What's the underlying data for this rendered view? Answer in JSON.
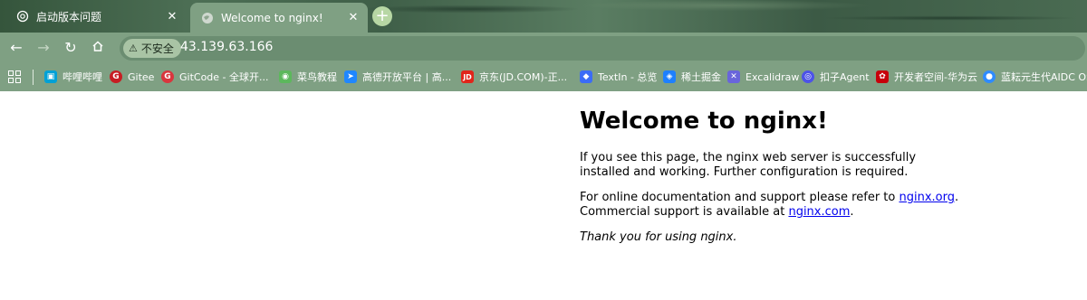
{
  "tabs": [
    {
      "title": "启动版本问题",
      "icon": "openai-icon",
      "active": false
    },
    {
      "title": "Welcome to nginx!",
      "icon": "globe-icon",
      "active": true
    }
  ],
  "toolbar": {
    "security_label": "不安全",
    "url": "43.139.63.166"
  },
  "bookmarks": [
    {
      "label": "哔哩哔哩",
      "color": "#00a1d6",
      "glyph": "▣"
    },
    {
      "label": "Gitee",
      "color": "#c71d23",
      "glyph": "G"
    },
    {
      "label": "GitCode - 全球开...",
      "color": "#d9363e",
      "glyph": "G"
    },
    {
      "label": "菜鸟教程",
      "color": "#5cb85c",
      "glyph": "◉"
    },
    {
      "label": "高德开放平台 | 高...",
      "color": "#1f87ff",
      "glyph": "➤"
    },
    {
      "label": "京东(JD.COM)-正...",
      "color": "#e1251b",
      "glyph": "JD"
    },
    {
      "label": "TextIn - 总览",
      "color": "#3b6cf6",
      "glyph": "◆"
    },
    {
      "label": "稀土掘金",
      "color": "#1e80ff",
      "glyph": "◈"
    },
    {
      "label": "Excalidraw",
      "color": "#6965db",
      "glyph": "✕"
    },
    {
      "label": "扣子Agent",
      "color": "#4d53e8",
      "glyph": "◎"
    },
    {
      "label": "开发者空间-华为云",
      "color": "#c7000b",
      "glyph": "✿"
    },
    {
      "label": "蓝耘元生代AIDC OS",
      "color": "#2e8bff",
      "glyph": "●"
    }
  ],
  "page": {
    "heading": "Welcome to nginx!",
    "p1": "If you see this page, the nginx web server is successfully installed and working. Further configuration is required.",
    "p2_prefix": "For online documentation and support please refer to ",
    "link_org": "nginx.org",
    "p2_mid": ".",
    "p2_line2_prefix": "Commercial support is available at ",
    "link_com": "nginx.com",
    "p2_suffix": ".",
    "thanks": "Thank you for using nginx."
  }
}
